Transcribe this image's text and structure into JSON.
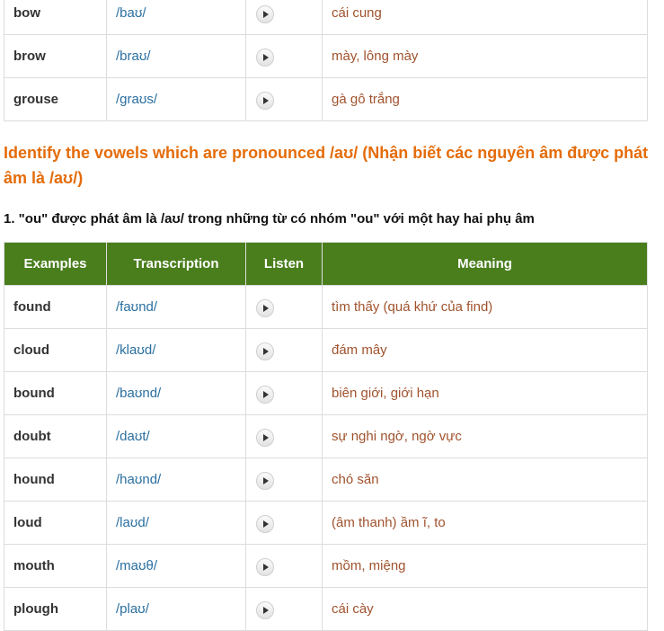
{
  "top_table": {
    "rows": [
      {
        "word": "bow",
        "ipa": "/baʊ/",
        "meaning": "cái cung"
      },
      {
        "word": "brow",
        "ipa": "/braʊ/",
        "meaning": "mày, lông mày"
      },
      {
        "word": "grouse",
        "ipa": "/graʊs/",
        "meaning": "gà gô trắng"
      }
    ]
  },
  "section": {
    "heading": "Identify the vowels which are pronounced /aʊ/ (Nhận biết các nguyên âm được phát âm là /aʊ/)",
    "subheading": "1. \"ou\" được phát âm là /aʊ/ trong những từ có nhóm \"ou\" với một hay hai phụ âm"
  },
  "main_table": {
    "headers": {
      "examples": "Examples",
      "transcription": "Transcription",
      "listen": "Listen",
      "meaning": "Meaning"
    },
    "header_bg": "#4a7e1d",
    "rows": [
      {
        "word": "found",
        "ipa": "/faʊnd/",
        "meaning": "tìm thấy (quá khứ của find)"
      },
      {
        "word": "cloud",
        "ipa": "/klaʊd/",
        "meaning": "đám mây"
      },
      {
        "word": "bound",
        "ipa": "/baʊnd/",
        "meaning": "biên giới, giới hạn"
      },
      {
        "word": "doubt",
        "ipa": "/daʊt/",
        "meaning": "sự nghi ngờ, ngờ vực"
      },
      {
        "word": "hound",
        "ipa": "/haʊnd/",
        "meaning": "chó săn"
      },
      {
        "word": "loud",
        "ipa": "/laʊd/",
        "meaning": "(âm thanh) ầm ĩ, to"
      },
      {
        "word": "mouth",
        "ipa": "/maʊθ/",
        "meaning": "mồm, miệng"
      },
      {
        "word": "plough",
        "ipa": "/plaʊ/",
        "meaning": "cái cày"
      }
    ]
  },
  "icons": {
    "play": "play-icon"
  }
}
